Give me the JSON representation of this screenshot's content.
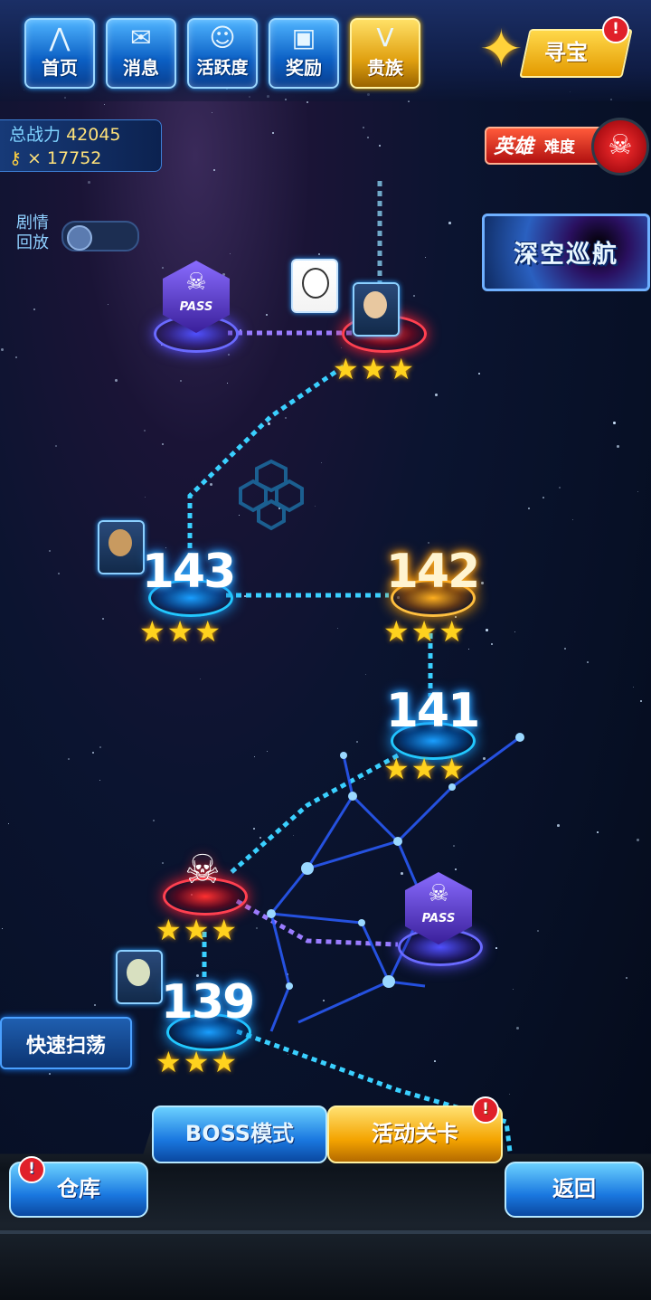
{
  "nav": {
    "items": [
      {
        "label": "首页",
        "icon": "home-icon"
      },
      {
        "label": "消息",
        "icon": "mail-icon"
      },
      {
        "label": "活跃度",
        "icon": "smiley-icon"
      },
      {
        "label": "奖励",
        "icon": "gift-icon"
      },
      {
        "label": "贵族",
        "icon": "noble-v-icon"
      }
    ],
    "treasure": {
      "label": "寻宝",
      "badge": "!"
    }
  },
  "stats": {
    "power_label": "总战力",
    "power_value": "42045",
    "keys_value": "× 17752"
  },
  "hero_difficulty": {
    "label_big": "英雄",
    "label_small": "难度"
  },
  "story_replay": {
    "line1": "剧情",
    "line2": "回放",
    "enabled": false
  },
  "deep_space": {
    "label": "深空巡航"
  },
  "map": {
    "nodes": [
      {
        "id": "pass-top",
        "type": "pass",
        "pass_text": "PASS"
      },
      {
        "id": "boss-top",
        "type": "boss",
        "stars": "★★★"
      },
      {
        "id": "143",
        "label": "143",
        "stars": "★★★"
      },
      {
        "id": "142",
        "label": "142",
        "stars": "★★★",
        "current": true
      },
      {
        "id": "141",
        "label": "141",
        "stars": "★★★"
      },
      {
        "id": "boss-mid",
        "type": "boss",
        "stars": "★★★"
      },
      {
        "id": "pass-mid",
        "type": "pass",
        "pass_text": "PASS"
      },
      {
        "id": "139",
        "label": "139",
        "stars": "★★★"
      }
    ]
  },
  "quick_sweep": {
    "label": "快速扫荡"
  },
  "bottom": {
    "boss_mode": "BOSS模式",
    "event_levels": "活动关卡",
    "event_badge": "!",
    "warehouse": "仓库",
    "warehouse_badge": "!",
    "back": "返回"
  },
  "colors": {
    "accent_blue": "#1aa0ff",
    "accent_gold": "#ffc400",
    "boss_red": "#ff2030",
    "pass_purple": "#5a50ff"
  }
}
